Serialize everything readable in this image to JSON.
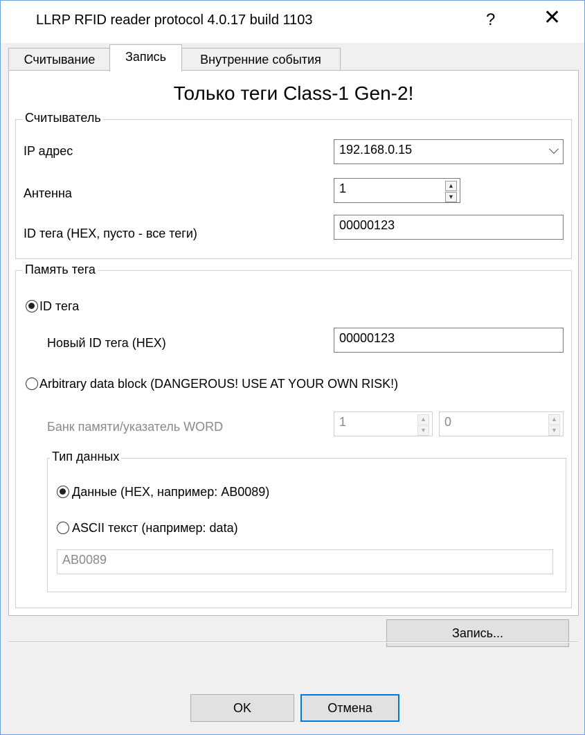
{
  "window": {
    "title": "LLRP RFID reader protocol 4.0.17 build 1103",
    "help": "?",
    "close": "✕"
  },
  "tabs": [
    "Считывание",
    "Запись",
    "Внутренние события"
  ],
  "heading": "Только теги Class-1 Gen-2!",
  "reader": {
    "legend": "Считыватель",
    "ip_label": "IP адрес",
    "ip_value": "192.168.0.15",
    "antenna_label": "Антенна",
    "antenna_value": "1",
    "tagid_label": "ID тега (HEX, пусто - все теги)",
    "tagid_value": "00000123"
  },
  "memory": {
    "legend": "Память тега",
    "radio_tagid": "ID тега",
    "radio_tagid_selected": true,
    "newid_label": "Новый ID тега (HEX)",
    "newid_value": "00000123",
    "radio_block": "Arbitrary data block (DANGEROUS! USE AT YOUR OWN RISK!)",
    "radio_block_selected": false,
    "bank_label": "Банк памяти/указатель WORD",
    "bank_value": "1",
    "pointer_value": "0",
    "datatype": {
      "legend": "Тип данных",
      "radio_hex": "Данные (HEX, например: AB0089)",
      "radio_hex_selected": true,
      "radio_ascii": "ASCII текст (например: data)",
      "radio_ascii_selected": false,
      "data_value": "AB0089"
    }
  },
  "write_button": "Запись...",
  "ok_button": "OK",
  "cancel_button": "Отмена"
}
